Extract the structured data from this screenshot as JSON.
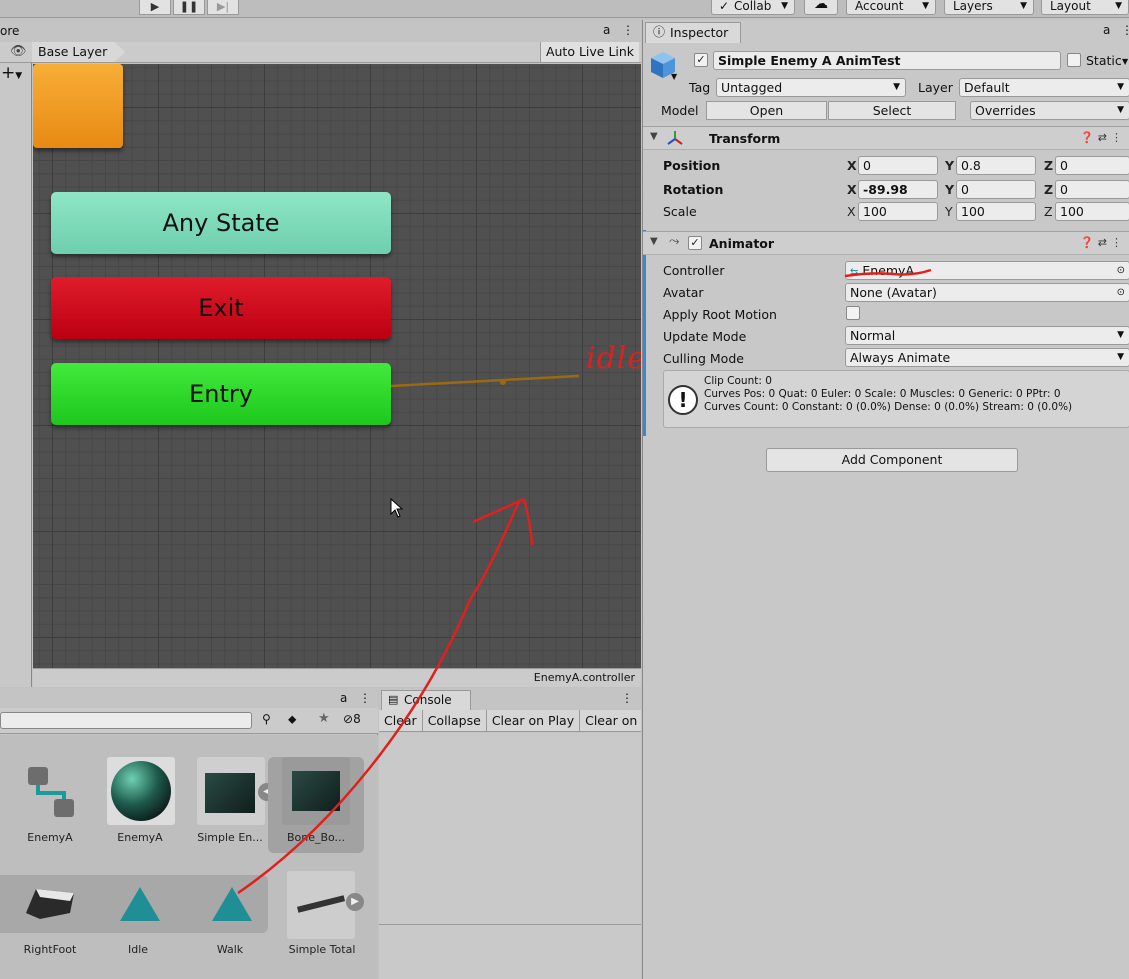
{
  "toolbar": {
    "collab_label": "Collab",
    "account_label": "Account",
    "layers_label": "Layers",
    "layout_label": "Layout"
  },
  "animator": {
    "tab_fragment": "ore",
    "layer_label": "Base Layer",
    "auto_live_link_label": "Auto Live Link",
    "footer_label": "EnemyA.controller",
    "states": {
      "any_state": "Any State",
      "exit": "Exit",
      "entry": "Entry",
      "idle_annotation": "idle"
    }
  },
  "project": {
    "hidden_count": "8",
    "assets_row1": [
      {
        "label": "EnemyA"
      },
      {
        "label": "EnemyA"
      },
      {
        "label": "Simple En..."
      },
      {
        "label": "Bone_Bo..."
      }
    ],
    "assets_row2": [
      {
        "label": "RightFoot"
      },
      {
        "label": "Idle"
      },
      {
        "label": "Walk"
      },
      {
        "label": "Simple Total"
      }
    ]
  },
  "console": {
    "tab_label": "Console",
    "buttons": [
      "Clear",
      "Collapse",
      "Clear on Play",
      "Clear on"
    ]
  },
  "inspector": {
    "tab_label": "Inspector",
    "object_name": "Simple Enemy A AnimTest",
    "static_label": "Static",
    "tag_label": "Tag",
    "tag_value": "Untagged",
    "layer_label": "Layer",
    "layer_value": "Default",
    "model_label": "Model",
    "open_label": "Open",
    "select_label": "Select",
    "overrides_label": "Overrides",
    "transform": {
      "title": "Transform",
      "position_label": "Position",
      "rotation_label": "Rotation",
      "scale_label": "Scale",
      "position": {
        "x": "0",
        "y": "0.8",
        "z": "0"
      },
      "rotation": {
        "x": "-89.98",
        "y": "0",
        "z": "0"
      },
      "scale": {
        "x": "100",
        "y": "100",
        "z": "100"
      }
    },
    "animator": {
      "title": "Animator",
      "controller_label": "Controller",
      "controller_value": "EnemyA",
      "avatar_label": "Avatar",
      "avatar_value": "None (Avatar)",
      "apply_root_motion_label": "Apply Root Motion",
      "update_mode_label": "Update Mode",
      "update_mode_value": "Normal",
      "culling_mode_label": "Culling Mode",
      "culling_mode_value": "Always Animate",
      "info_line1": "Clip Count: 0",
      "info_line2": "Curves Pos: 0 Quat: 0 Euler: 0 Scale: 0 Muscles: 0 Generic: 0 PPtr: 0",
      "info_line3": "Curves Count: 0 Constant: 0 (0.0%) Dense: 0 (0.0%) Stream: 0 (0.0%)"
    },
    "add_component_label": "Add Component"
  },
  "colors": {
    "any_state": "#7fdcba",
    "exit": "#cc0a1c",
    "entry": "#2ddb2a",
    "idle": "#f0a028",
    "graph_bg": "#505050",
    "annotation": "#e0201c"
  }
}
